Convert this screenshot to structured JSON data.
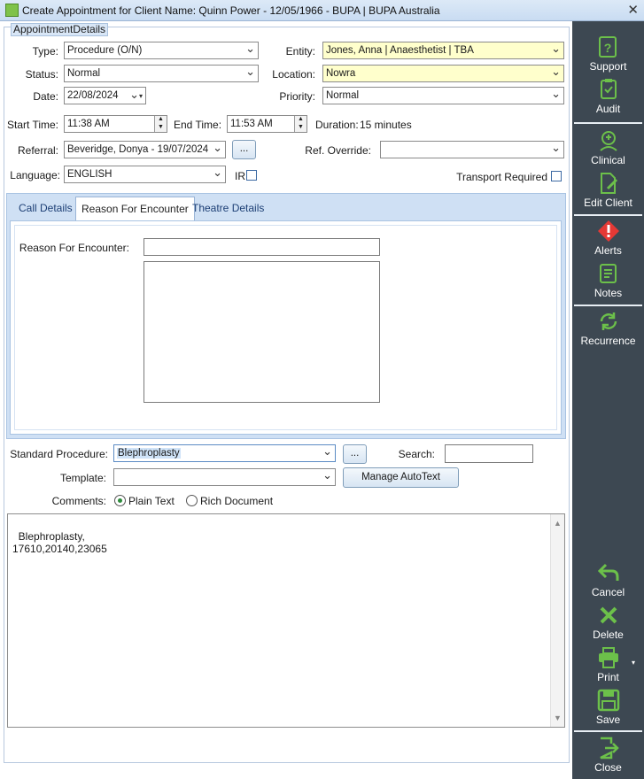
{
  "window": {
    "title": "Create Appointment for Client Name: Quinn Power - 12/05/1966 - BUPA | BUPA Australia",
    "close_glyph": "✕"
  },
  "group": {
    "legend": "AppointmentDetails"
  },
  "fields": {
    "type_label": "Type:",
    "type_value": "Procedure (O/N)",
    "entity_label": "Entity:",
    "entity_value": "Jones, Anna | Anaesthetist | TBA",
    "status_label": "Status:",
    "status_value": "Normal",
    "location_label": "Location:",
    "location_value": "Nowra",
    "date_label": "Date:",
    "date_value": "22/08/2024",
    "priority_label": "Priority:",
    "priority_value": "Normal",
    "start_label": "Start Time:",
    "start_value": "11:38 AM",
    "end_label": "End Time:",
    "end_value": "11:53 AM",
    "duration_label": "Duration:",
    "duration_value": "15 minutes",
    "referral_label": "Referral:",
    "referral_value": "Beveridge, Donya - 19/07/2024 (",
    "referral_btn": "...",
    "refoverride_label": "Ref. Override:",
    "refoverride_value": "",
    "language_label": "Language:",
    "language_value": "ENGLISH",
    "ir_label": "IR",
    "transport_label": "Transport Required"
  },
  "tabs": [
    {
      "label": "Call Details"
    },
    {
      "label": "Reason For Encounter"
    },
    {
      "label": "Theatre Details"
    }
  ],
  "reason": {
    "label": "Reason For Encounter:",
    "value": "",
    "notes": ""
  },
  "procedure": {
    "standard_label": "Standard Procedure:",
    "standard_value": "Blephroplasty",
    "browse_btn": "...",
    "search_label": "Search:",
    "search_value": "",
    "template_label": "Template:",
    "template_value": "",
    "autotext_btn": "Manage AutoText",
    "comments_label": "Comments:",
    "plain_text": "Plain Text",
    "rich_document": "Rich Document",
    "comment_text": "Blephroplasty,\n17610,20140,23065"
  },
  "sidebar": {
    "support": "Support",
    "audit": "Audit",
    "clinical": "Clinical",
    "edit_client": "Edit Client",
    "alerts": "Alerts",
    "notes": "Notes",
    "recurrence": "Recurrence",
    "cancel": "Cancel",
    "delete": "Delete",
    "print": "Print",
    "save": "Save",
    "close": "Close"
  },
  "colors": {
    "sidebar_bg": "#3d4852",
    "icon_green": "#6cc04a",
    "alert_red": "#e53935"
  }
}
